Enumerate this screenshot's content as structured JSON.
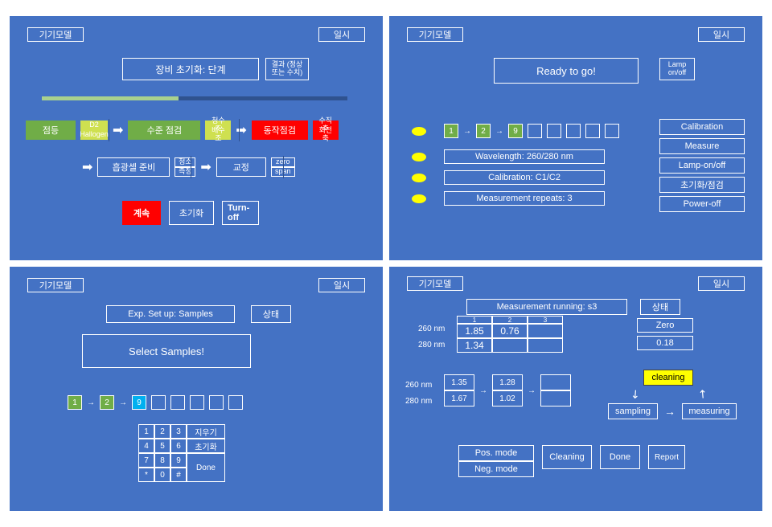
{
  "common": {
    "model": "기기모델",
    "datetime": "일시",
    "status": "상태"
  },
  "p1": {
    "init_title": "장비 초기화: 단계",
    "result_label": "결과 (정상 또는 수치)",
    "lamp_on": "점등",
    "d2": "D2",
    "halogen": "Hallogen",
    "level_check": "수준 점검",
    "fresh": "청수조",
    "waste": "배수조",
    "motion_check": "동작점검",
    "vert": "수직축",
    "rot": "회전축",
    "cell_prep": "흡광셀 준비",
    "clean": "청소",
    "fill": "측정",
    "calib": "교정",
    "zero": "zero",
    "span": "span",
    "continue": "계속",
    "initialize": "초기화",
    "turnoff": "Turn-off"
  },
  "p2": {
    "ready": "Ready to go!",
    "lamp_onoff": "Lamp on/off",
    "seq": [
      "1",
      "2",
      "9"
    ],
    "wavelength": "Wavelength: 260/280 nm",
    "calibration": "Calibration: C1/C2",
    "repeats": "Measurement repeats: 3",
    "btn_cal": "Calibration",
    "btn_meas": "Measure",
    "btn_lamp": "Lamp-on/off",
    "btn_init": "초기화/점검",
    "btn_off": "Power-off"
  },
  "p3": {
    "setup": "Exp. Set up: Samples",
    "select": "Select Samples!",
    "seq": [
      "1",
      "2",
      "9"
    ],
    "keys": [
      "1",
      "2",
      "3",
      "4",
      "5",
      "6",
      "7",
      "8",
      "9",
      "*",
      "0",
      "#"
    ],
    "key_clear": "지우기",
    "key_init": "초기화",
    "key_done": "Done"
  },
  "p4": {
    "running": "Measurement running: s3",
    "row260": "260 nm",
    "row280": "280 nm",
    "th": [
      "1",
      "2",
      "3"
    ],
    "r260": [
      "1.85",
      "0.76",
      ""
    ],
    "r280": [
      "1.34",
      "",
      ""
    ],
    "zero": "Zero",
    "zero_val": "0.18",
    "t260": [
      "1.35",
      "1.28",
      ""
    ],
    "t280": [
      "1.67",
      "1.02",
      ""
    ],
    "cleaning": "cleaning",
    "sampling": "sampling",
    "measuring": "measuring",
    "pos": "Pos. mode",
    "neg": "Neg. mode",
    "btn_clean": "Cleaning",
    "btn_done": "Done",
    "btn_report": "Report"
  }
}
